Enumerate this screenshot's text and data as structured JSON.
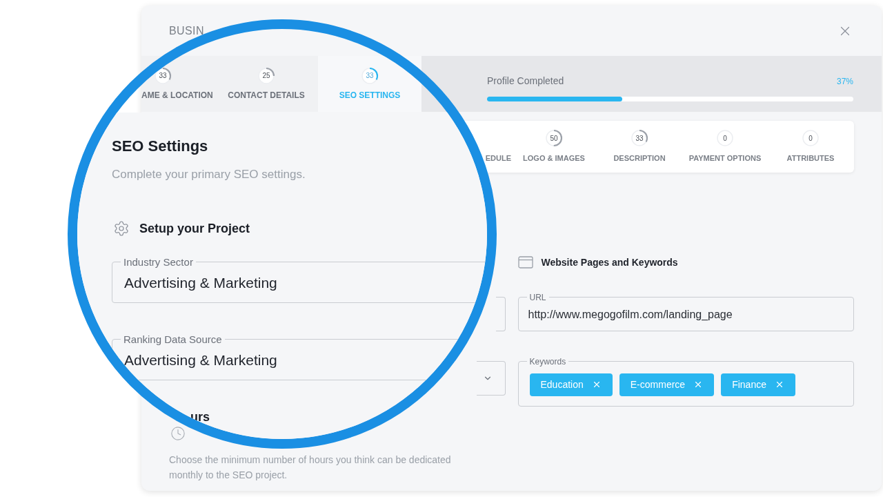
{
  "window": {
    "title": "BUSIN"
  },
  "tabs": [
    {
      "label": "AME & LOCATION",
      "count": "33",
      "level": 0.33,
      "selected": false
    },
    {
      "label": "CONTACT DETAILS",
      "count": "25",
      "level": 0.25,
      "selected": false
    },
    {
      "label": "SEO SETTINGS",
      "count": "33",
      "level": 0.33,
      "selected": true
    }
  ],
  "profile": {
    "label": "Profile Completed",
    "percent": "37%",
    "level": 0.37
  },
  "steps": [
    {
      "label": "EDULE"
    },
    {
      "label": "LOGO & IMAGES",
      "count": "50",
      "level": 0.5
    },
    {
      "label": "DESCRIPTION",
      "count": "33",
      "level": 0.33
    },
    {
      "label": "PAYMENT OPTIONS",
      "count": "0",
      "level": 0
    },
    {
      "label": "ATTRIBUTES",
      "count": "0",
      "level": 0
    }
  ],
  "website_section": {
    "heading": "Website Pages and Keywords",
    "url": {
      "label": "URL",
      "value": "http://www.megogofilm.com/landing_page"
    },
    "keywords": {
      "label": "Keywords",
      "tags": [
        "Education",
        "E-commerce",
        "Finance"
      ]
    }
  },
  "hours_section": {
    "heading_fragment": "urs",
    "description": "Choose the minimum number of hours you think can be dedicated monthly to the SEO project."
  },
  "magnifier": {
    "title": "SEO Settings",
    "subtitle": "Complete your primary SEO settings.",
    "section": "Setup your Project",
    "fields": [
      {
        "label": "Industry Sector",
        "value": "Advertising & Marketing"
      },
      {
        "label": "Ranking Data Source",
        "value": "Advertising & Marketing"
      }
    ]
  }
}
